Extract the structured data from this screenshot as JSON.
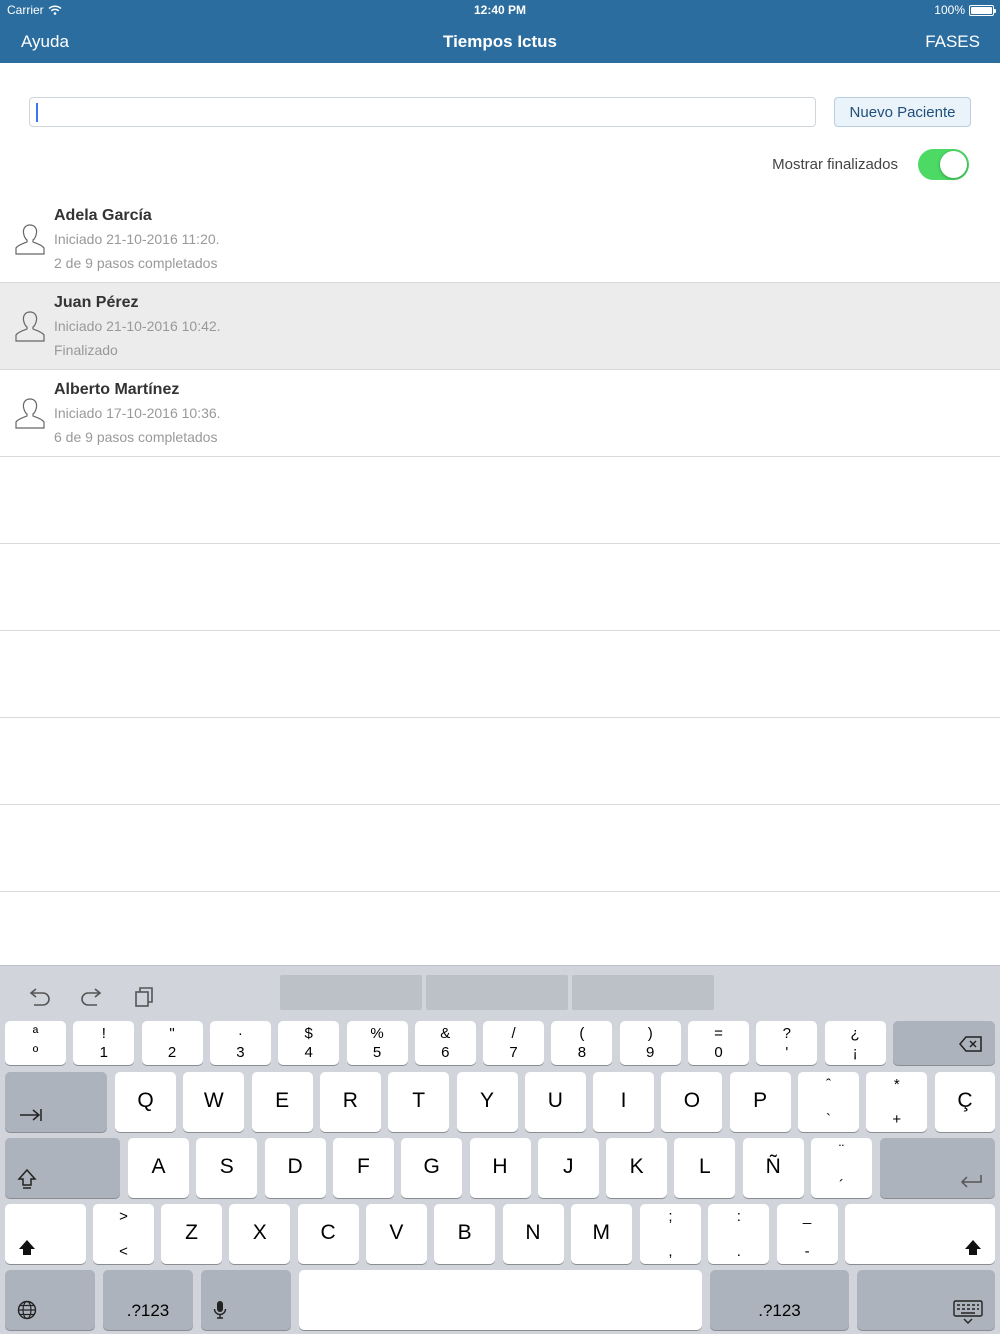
{
  "status": {
    "carrier": "Carrier",
    "time": "12:40 PM",
    "battery": "100%"
  },
  "nav": {
    "left": "Ayuda",
    "title": "Tiempos Ictus",
    "right": "FASES"
  },
  "search": {
    "value": ""
  },
  "new_patient_button": "Nuevo Paciente",
  "show_finished": {
    "label": "Mostrar finalizados",
    "on": true
  },
  "patients": [
    {
      "name": "Adela García",
      "started": "Iniciado 21-10-2016 11:20.",
      "progress": "2 de 9 pasos completados",
      "selected": false
    },
    {
      "name": "Juan Pérez",
      "started": "Iniciado 21-10-2016 10:42.",
      "progress": "Finalizado",
      "selected": true
    },
    {
      "name": "Alberto Martínez",
      "started": "Iniciado 17-10-2016 10:36.",
      "progress": "6 de 9 pasos completados",
      "selected": false
    }
  ],
  "keyboard": {
    "num_row": [
      {
        "top": "ª",
        "bot": "º"
      },
      {
        "top": "!",
        "bot": "1"
      },
      {
        "top": "\"",
        "bot": "2"
      },
      {
        "top": "·",
        "bot": "3"
      },
      {
        "top": "$",
        "bot": "4"
      },
      {
        "top": "%",
        "bot": "5"
      },
      {
        "top": "&",
        "bot": "6"
      },
      {
        "top": "/",
        "bot": "7"
      },
      {
        "top": "(",
        "bot": "8"
      },
      {
        "top": ")",
        "bot": "9"
      },
      {
        "top": "=",
        "bot": "0"
      },
      {
        "top": "?",
        "bot": "'"
      },
      {
        "top": "¿",
        "bot": "¡"
      }
    ],
    "row_q": [
      "Q",
      "W",
      "E",
      "R",
      "T",
      "Y",
      "U",
      "I",
      "O",
      "P"
    ],
    "row_q_extra": [
      {
        "top": "ˆ",
        "bot": "`"
      },
      {
        "top": "*",
        "bot": "+"
      }
    ],
    "row_q_last": "Ç",
    "row_a": [
      "A",
      "S",
      "D",
      "F",
      "G",
      "H",
      "J",
      "K",
      "L",
      "Ñ"
    ],
    "row_a_extra": {
      "top": "¨",
      "bot": "´"
    },
    "row_z_first": {
      "top": ">",
      "bot": "<"
    },
    "row_z": [
      "Z",
      "X",
      "C",
      "V",
      "B",
      "N",
      "M"
    ],
    "row_z_extra": [
      {
        "top": ";",
        "bot": ","
      },
      {
        "top": ":",
        "bot": "."
      },
      {
        "top": "_",
        "bot": "-"
      }
    ],
    "numbers_label": ".?123"
  }
}
